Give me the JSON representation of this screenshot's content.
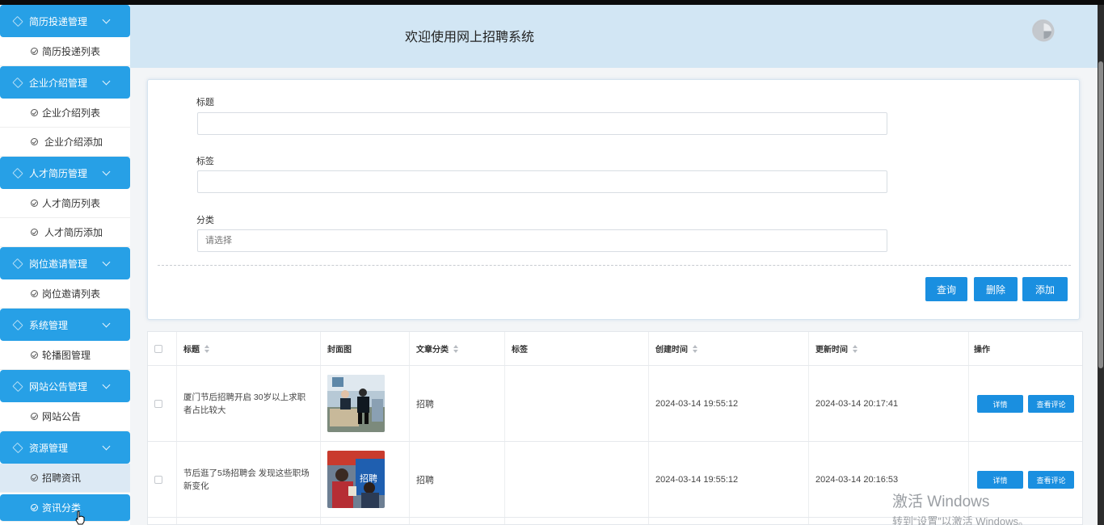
{
  "header": {
    "title": "欢迎使用网上招聘系统"
  },
  "sidebar": {
    "groups": [
      {
        "label": "简历投递管理",
        "items": [
          "简历投递列表"
        ]
      },
      {
        "label": "企业介绍管理",
        "items": [
          "企业介绍列表",
          "企业介绍添加"
        ]
      },
      {
        "label": "人才简历管理",
        "items": [
          "人才简历列表",
          "人才简历添加"
        ]
      },
      {
        "label": "岗位邀请管理",
        "items": [
          "岗位邀请列表"
        ]
      },
      {
        "label": "系统管理",
        "items": [
          "轮播图管理"
        ]
      },
      {
        "label": "网站公告管理",
        "items": [
          "网站公告"
        ]
      },
      {
        "label": "资源管理",
        "items": [
          "招聘资讯",
          "资讯分类"
        ]
      }
    ]
  },
  "search": {
    "title_label": "标题",
    "tag_label": "标签",
    "category_label": "分类",
    "category_placeholder": "请选择",
    "query_button": "查询",
    "delete_button": "删除",
    "add_button": "添加"
  },
  "table": {
    "columns": [
      "标题",
      "封面图",
      "文章分类",
      "标签",
      "创建时间",
      "更新时间",
      "操作"
    ],
    "rows": [
      {
        "title": "厦门节后招聘开启 30岁以上求职者占比较大",
        "category": "招聘",
        "tag": "",
        "created": "2024-03-14 19:55:12",
        "updated": "2024-03-14 20:17:41",
        "detail": "详情",
        "comments": "查看评论"
      },
      {
        "title": "节后逛了5场招聘会 发现这些职场新变化",
        "category": "招聘",
        "tag": "",
        "created": "2024-03-14 19:55:12",
        "updated": "2024-03-14 20:16:53",
        "detail": "详情",
        "comments": "查看评论"
      }
    ],
    "thumb2_sign": "招聘"
  },
  "watermark": {
    "line1": "激活 Windows",
    "line2": "转到“设置”以激活 Windows。"
  },
  "colors": {
    "accent": "#27a0e6",
    "button": "#1a8fe0",
    "header_bg": "#d2e6f4"
  }
}
